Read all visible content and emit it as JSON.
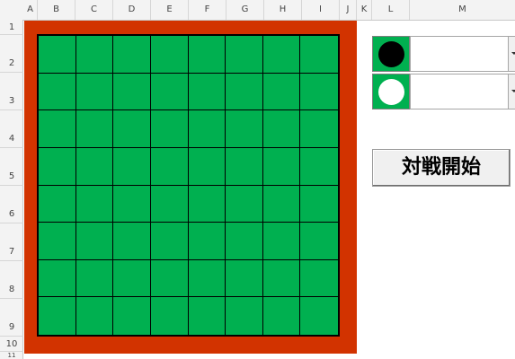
{
  "sheet": {
    "columns": [
      "A",
      "B",
      "C",
      "D",
      "E",
      "F",
      "G",
      "H",
      "I",
      "J",
      "K",
      "L",
      "M"
    ],
    "rows": [
      "1",
      "2",
      "3",
      "4",
      "5",
      "6",
      "7",
      "8",
      "9",
      "10",
      "11"
    ]
  },
  "players": [
    {
      "stone": "black",
      "selected": ""
    },
    {
      "stone": "white",
      "selected": ""
    }
  ],
  "start_button": {
    "label": "対戦開始"
  },
  "colors": {
    "board_green": "#00b050",
    "board_frame": "#d23300"
  }
}
